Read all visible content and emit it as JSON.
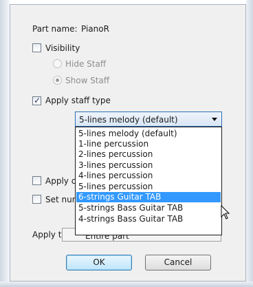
{
  "part": {
    "label": "Part name:",
    "value": "PianoR"
  },
  "visibility": {
    "label": "Visibility",
    "checked": false,
    "hide_staff": "Hide Staff",
    "show_staff": "Show Staff"
  },
  "apply_staff_type": {
    "label": "Apply staff type",
    "checked": true,
    "selected": "5-lines melody (default)",
    "options": [
      "5-lines melody (default)",
      "1-line percussion",
      "2-lines percussion",
      "3-lines percussion",
      "4-lines percussion",
      "5-lines percussion",
      "6-strings Guitar TAB",
      "5-strings Bass Guitar TAB",
      "4-strings Bass Guitar TAB"
    ],
    "highlighted_option": "6-strings Guitar TAB"
  },
  "apply_cu": {
    "label": "Apply cu"
  },
  "set_numb": {
    "label": "Set numb"
  },
  "apply_to": {
    "label": "Apply to:",
    "value": "Entire part"
  },
  "buttons": {
    "ok": "OK",
    "cancel": "Cancel"
  },
  "colors": {
    "selection": "#3399ff",
    "focus_border": "#2f6fb2"
  }
}
